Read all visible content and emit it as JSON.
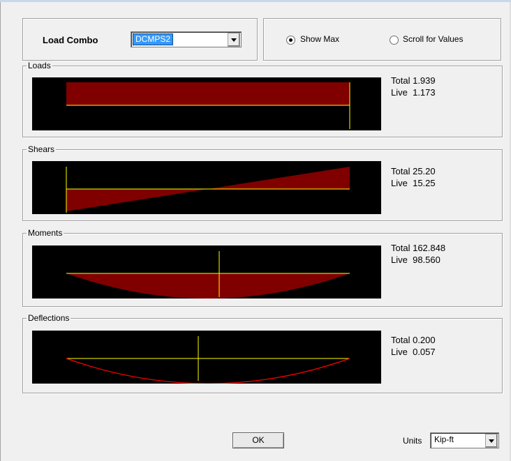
{
  "header": {
    "load_combo_label": "Load Combo",
    "load_combo_value": "DCMPS2",
    "show_max_label": "Show Max",
    "show_max_selected": true,
    "scroll_values_label": "Scroll for Values",
    "scroll_values_selected": false
  },
  "panels": {
    "loads": {
      "title": "Loads",
      "total_label": "Total",
      "total": "1.939",
      "live_label": "Live",
      "live": "1.173"
    },
    "shears": {
      "title": "Shears",
      "total_label": "Total",
      "total": "25.20",
      "live_label": "Live",
      "live": "15.25"
    },
    "moments": {
      "title": "Moments",
      "total_label": "Total",
      "total": "162.848",
      "live_label": "Live",
      "live": "98.560"
    },
    "deflections": {
      "title": "Deflections",
      "total_label": "Total",
      "total": "0.200",
      "live_label": "Live",
      "live": "0.057"
    }
  },
  "footer": {
    "ok_label": "OK",
    "units_label": "Units",
    "units_value": "Kip-ft"
  },
  "colors": {
    "plot_background": "#000000",
    "diagram_fill": "#800000",
    "axis_line": "#ffff00",
    "deflection_curve": "#ff0000"
  }
}
